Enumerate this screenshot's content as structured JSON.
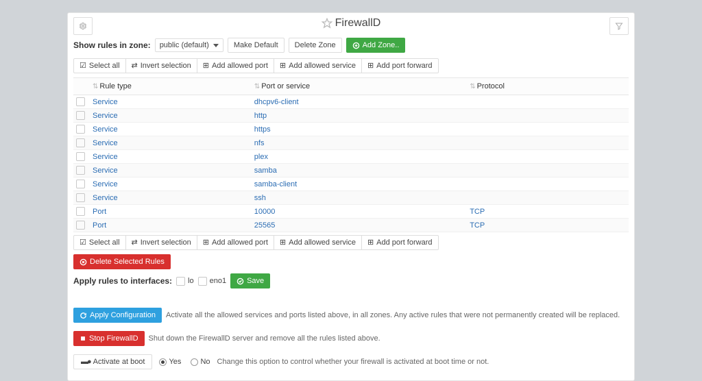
{
  "header": {
    "title": "FirewallD"
  },
  "zone_bar": {
    "show_label": "Show rules in zone:",
    "zone_selected": "public (default)",
    "make_default": "Make Default",
    "delete_zone": "Delete Zone",
    "add_zone": "Add Zone.."
  },
  "toolbar": {
    "select_all": "Select all",
    "invert": "Invert selection",
    "add_port": "Add allowed port",
    "add_service": "Add allowed service",
    "add_forward": "Add port forward"
  },
  "table": {
    "headers": {
      "type": "Rule type",
      "port": "Port or service",
      "proto": "Protocol"
    },
    "rows": [
      {
        "type": "Service",
        "port": "dhcpv6-client",
        "proto": ""
      },
      {
        "type": "Service",
        "port": "http",
        "proto": ""
      },
      {
        "type": "Service",
        "port": "https",
        "proto": ""
      },
      {
        "type": "Service",
        "port": "nfs",
        "proto": ""
      },
      {
        "type": "Service",
        "port": "plex",
        "proto": ""
      },
      {
        "type": "Service",
        "port": "samba",
        "proto": ""
      },
      {
        "type": "Service",
        "port": "samba-client",
        "proto": ""
      },
      {
        "type": "Service",
        "port": "ssh",
        "proto": ""
      },
      {
        "type": "Port",
        "port": "10000",
        "proto": "TCP"
      },
      {
        "type": "Port",
        "port": "25565",
        "proto": "TCP"
      }
    ]
  },
  "actions": {
    "delete_selected": "Delete Selected Rules",
    "apply_ifaces_label": "Apply rules to interfaces:",
    "iface1": "lo",
    "iface2": "eno1",
    "save": "Save"
  },
  "apply_cfg": {
    "btn": "Apply Configuration",
    "desc": "Activate all the allowed services and ports listed above, in all zones. Any active rules that were not permanently created will be replaced."
  },
  "stop": {
    "btn": "Stop FirewallD",
    "desc": "Shut down the FirewallD server and remove all the rules listed above."
  },
  "boot": {
    "btn": "Activate at boot",
    "yes": "Yes",
    "no": "No",
    "desc": "Change this option to control whether your firewall is activated at boot time or not."
  }
}
